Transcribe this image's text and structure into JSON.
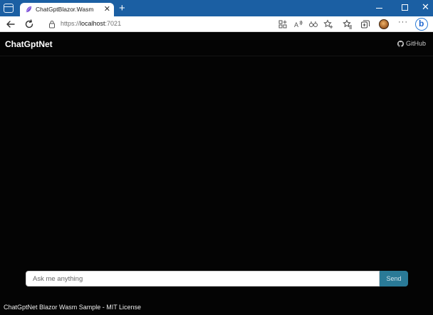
{
  "browser": {
    "tab_title": "ChatGptBlazor.Wasm",
    "tab_close": "✕",
    "new_tab": "+",
    "url_scheme": "https://",
    "url_host": "localhost",
    "url_port": ":7021",
    "window_close": "✕",
    "more_label": "···",
    "bing_label": "b",
    "colors": {
      "titlebar": "#1b5fa3",
      "toolbar": "#ffffff"
    }
  },
  "app": {
    "brand": "ChatGptNet",
    "github_label": "GitHub",
    "input_placeholder": "Ask me anything",
    "input_value": "",
    "send_label": "Send",
    "footer": "ChatGptNet Blazor Wasm Sample - MIT License",
    "colors": {
      "background": "#040404",
      "send_button": "#2a7a97"
    }
  },
  "icons": [
    "tab-actions-icon",
    "favicon-icon",
    "back-icon",
    "refresh-icon",
    "lock-icon",
    "app-available-icon",
    "read-aloud-icon",
    "immersive-reader-icon",
    "favorite-add-icon",
    "favorites-icon",
    "collections-icon",
    "github-icon"
  ]
}
